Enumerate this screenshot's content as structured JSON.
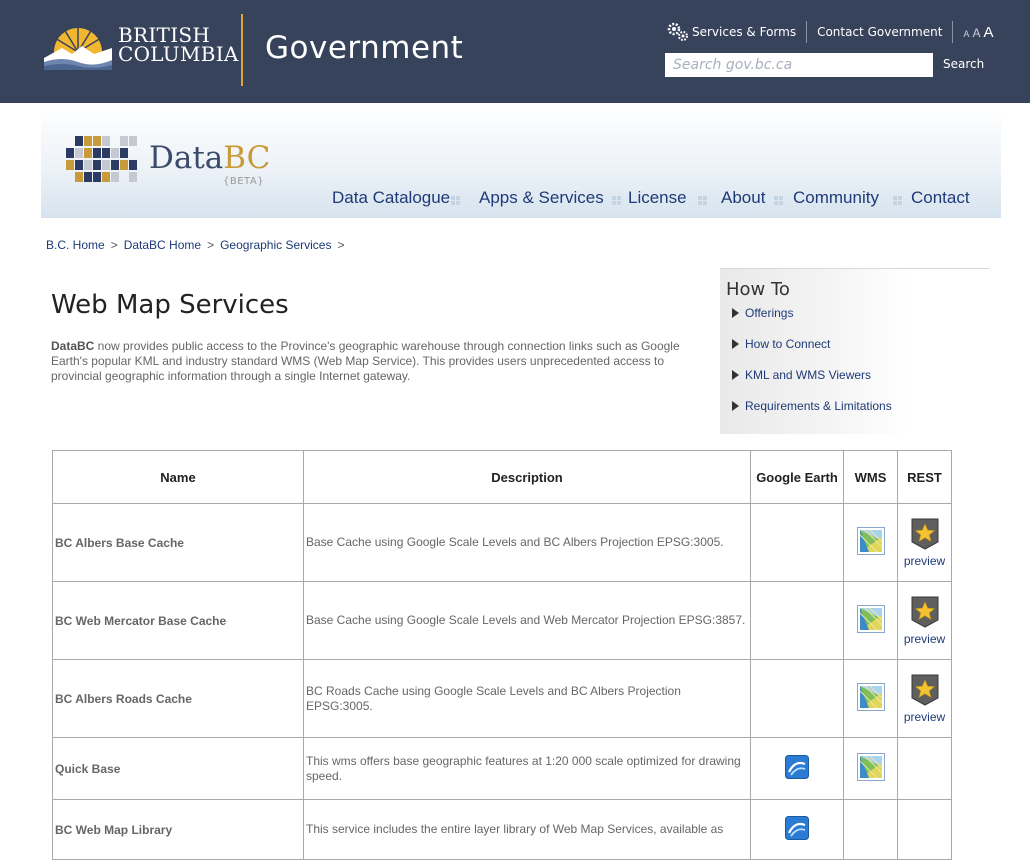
{
  "gov_header": {
    "logo_line1": "BRITISH",
    "logo_line2": "COLUMBIA",
    "title": "Government",
    "services_link": "Services & Forms",
    "contact_link": "Contact Government",
    "text_size": [
      "A",
      "A",
      "A"
    ],
    "search_placeholder": "Search gov.bc.ca",
    "search_button": "Search"
  },
  "databc": {
    "name_part1": "Data",
    "name_part2": "BC",
    "beta": "{BETA}"
  },
  "nav": [
    {
      "label": "Data Catalogue"
    },
    {
      "label": "Apps & Services"
    },
    {
      "label": "License"
    },
    {
      "label": "About"
    },
    {
      "label": "Community"
    },
    {
      "label": "Contact"
    }
  ],
  "breadcrumb": [
    {
      "label": "B.C. Home"
    },
    {
      "label": "DataBC Home"
    },
    {
      "label": "Geographic Services"
    }
  ],
  "breadcrumb_sep": ">",
  "page": {
    "title": "Web Map Services",
    "intro_bold": "DataBC",
    "intro_text": " now provides public access to the Province's geographic warehouse through connection links such as Google Earth's popular KML and industry standard WMS (Web Map Service). This provides users unprecedented access to provincial geographic information through a single Internet gateway."
  },
  "howto": {
    "title": "How To",
    "links": [
      {
        "label": "Offerings"
      },
      {
        "label": "How to Connect"
      },
      {
        "label": "KML and WMS Viewers"
      },
      {
        "label": "Requirements & Limitations"
      }
    ]
  },
  "table": {
    "headers": [
      "Name",
      "Description",
      "Google Earth",
      "WMS",
      "REST"
    ],
    "rows": [
      {
        "name": "BC Albers Base Cache",
        "description": "Base Cache using Google Scale Levels and BC Albers Projection EPSG:3005.",
        "google_earth": false,
        "wms": true,
        "rest": true,
        "rest_label": "preview"
      },
      {
        "name": "BC Web Mercator Base Cache",
        "description": "Base Cache using Google Scale Levels and Web Mercator Projection EPSG:3857.",
        "google_earth": false,
        "wms": true,
        "rest": true,
        "rest_label": "preview"
      },
      {
        "name": "BC Albers Roads Cache",
        "description": "BC Roads Cache using Google Scale Levels and BC Albers Projection EPSG:3005.",
        "google_earth": false,
        "wms": true,
        "rest": true,
        "rest_label": "preview"
      },
      {
        "name": "Quick Base",
        "description": "This wms offers base geographic features at 1:20 000 scale optimized for drawing speed.",
        "google_earth": true,
        "wms": true,
        "rest": false,
        "rest_label": ""
      },
      {
        "name": "BC Web Map Library",
        "description": "This service includes the entire layer library of Web Map Services, available as",
        "google_earth": true,
        "wms": false,
        "rest": false,
        "rest_label": ""
      }
    ]
  },
  "colors": {
    "gov_bar": "#36435a",
    "gold_accent": "#e3a42a",
    "link": "#1f3a78"
  }
}
